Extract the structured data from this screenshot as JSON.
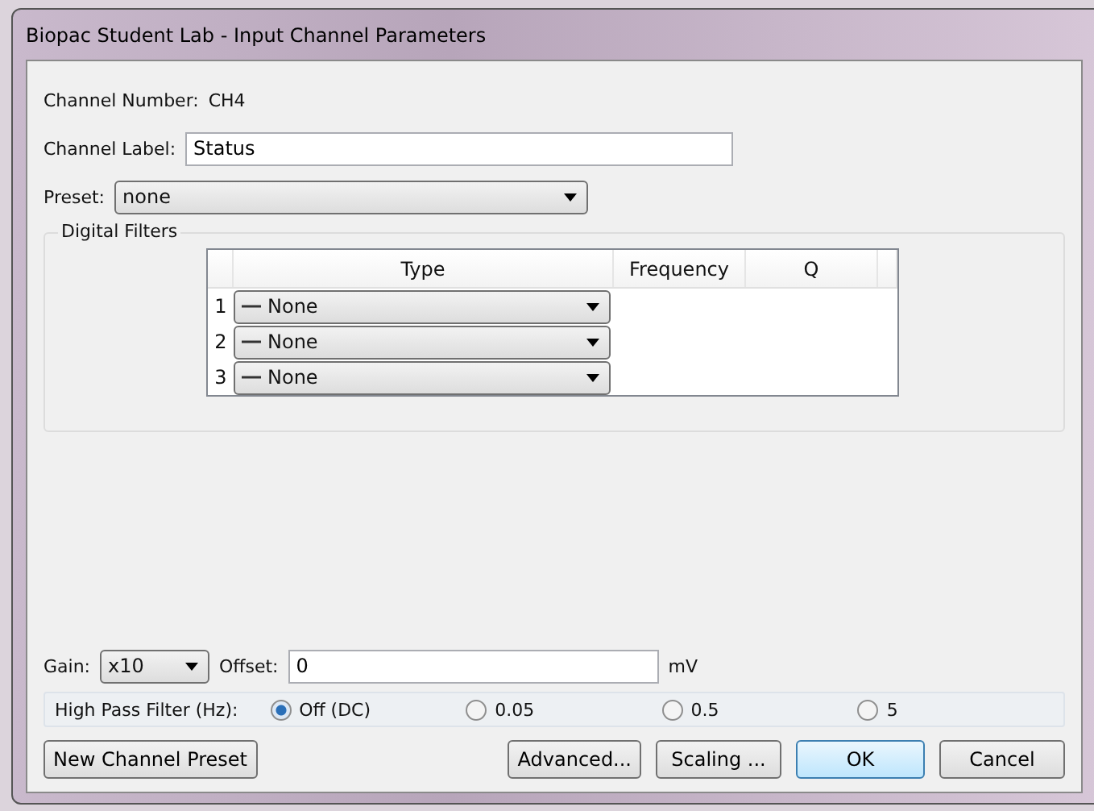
{
  "window": {
    "title": "Biopac Student Lab - Input Channel Parameters"
  },
  "channel_number": {
    "label": "Channel Number:",
    "value": "CH4"
  },
  "channel_label": {
    "label": "Channel Label:",
    "value": "Status"
  },
  "preset": {
    "label": "Preset:",
    "value": "none"
  },
  "digital_filters": {
    "title": "Digital Filters",
    "columns": [
      "Type",
      "Frequency",
      "Q"
    ],
    "rows": [
      {
        "index": "1",
        "type": "None"
      },
      {
        "index": "2",
        "type": "None"
      },
      {
        "index": "3",
        "type": "None"
      }
    ]
  },
  "gain": {
    "label": "Gain:",
    "value": "x10"
  },
  "offset": {
    "label": "Offset:",
    "value": "0",
    "unit": "mV"
  },
  "high_pass_filter": {
    "label": "High Pass Filter (Hz):",
    "options": [
      {
        "label": "Off (DC)",
        "selected": true
      },
      {
        "label": "0.05",
        "selected": false
      },
      {
        "label": "0.5",
        "selected": false
      },
      {
        "label": "5",
        "selected": false
      }
    ]
  },
  "new_preset_button": "New Channel Preset",
  "buttons": [
    {
      "label": "Advanced...",
      "default": false
    },
    {
      "label": "Scaling ...",
      "default": false
    },
    {
      "label": "OK",
      "default": true
    },
    {
      "label": "Cancel",
      "default": false
    }
  ]
}
